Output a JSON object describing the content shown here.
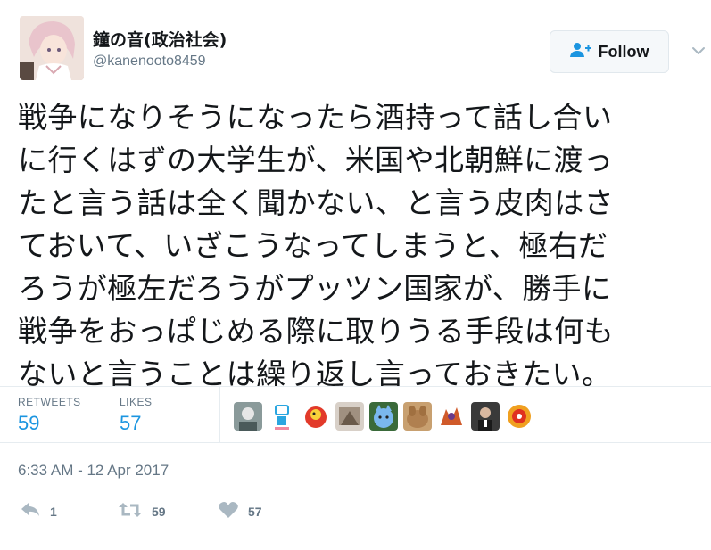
{
  "tweet": {
    "author_name": "鐘の音(政治社会)",
    "author_handle": "@kanenooto8459",
    "follow_label": "Follow",
    "text": "戦争になりそうになったら酒持って話し合い\nに行くはずの大学生が、米国や北朝鮮に渡っ\nたと言う話は全く聞かない、と言う皮肉はさ\nておいて、いざこうなってしまうと、極右だ\nろうが極左だろうがプッツン国家が、勝手に\n戦争をおっぱじめる際に取りうる手段は何も\nないと言うことは繰り返し言っておきたい。",
    "timestamp": "6:33 AM - 12 Apr 2017"
  },
  "stats": {
    "retweets_label": "RETWEETS",
    "retweets_value": "59",
    "likes_label": "LIKES",
    "likes_value": "57"
  },
  "actions": {
    "reply_count": "1",
    "retweet_count": "59",
    "like_count": "57"
  },
  "colors": {
    "accent": "#1b95e0",
    "muted": "#657786",
    "border": "#e6ecf0"
  }
}
